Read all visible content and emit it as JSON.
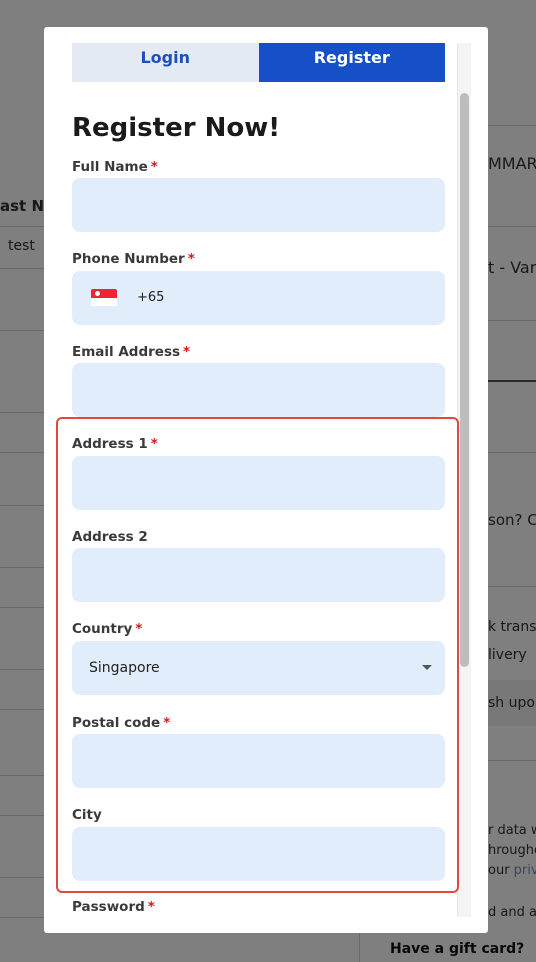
{
  "background": {
    "last_name_header": "ast Na",
    "test_cell": "test",
    "summary_heading": "MMARY",
    "product_fragment": "t - Vari",
    "coupon_fragment": "son? C",
    "payment_transfer": "k transf",
    "payment_delivery": "livery",
    "payment_cash": "sh upo",
    "privacy_line1": "r data w",
    "privacy_line2": "hroughou",
    "privacy_line3_prefix": "our ",
    "privacy_line3_link": "priv",
    "terms_fragment": "d and ag",
    "gift_card": "Have a gift card?"
  },
  "modal": {
    "tabs": {
      "login": "Login",
      "register": "Register"
    },
    "heading": "Register Now!",
    "required_marker": "*",
    "fields": {
      "full_name": {
        "label": "Full Name",
        "value": ""
      },
      "phone": {
        "label": "Phone Number",
        "dial_code": "+65",
        "flag_icon": "singapore-flag-icon",
        "value": ""
      },
      "email": {
        "label": "Email Address",
        "value": ""
      },
      "address1": {
        "label": "Address 1",
        "value": ""
      },
      "address2": {
        "label": "Address 2",
        "value": ""
      },
      "country": {
        "label": "Country",
        "value": "Singapore"
      },
      "postal_code": {
        "label": "Postal code",
        "value": ""
      },
      "city": {
        "label": "City",
        "value": ""
      },
      "password": {
        "label": "Password"
      }
    }
  },
  "colors": {
    "primary": "#1650c8",
    "input_bg": "#e2edfc",
    "required": "#d11a1a",
    "highlight": "#e04a3b"
  }
}
